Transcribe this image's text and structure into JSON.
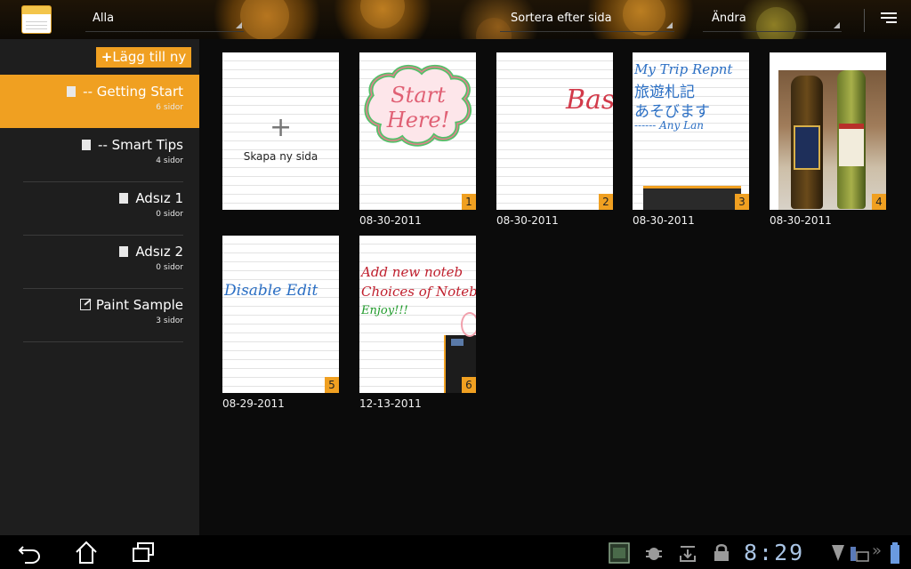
{
  "actionbar": {
    "filter_label": "Alla",
    "sort_label": "Sortera efter sida",
    "edit_label": "Ändra"
  },
  "sidebar": {
    "add_label": "Lägg till ny",
    "notebooks": [
      {
        "title": "-- Getting Start",
        "count": "6 sidor",
        "active": true
      },
      {
        "title": "-- Smart Tips",
        "count": "4 sidor"
      },
      {
        "title": "Adsız 1",
        "count": "0 sidor"
      },
      {
        "title": "Adsız 2",
        "count": "0 sidor"
      },
      {
        "title": "Paint Sample",
        "count": "3 sidor"
      }
    ]
  },
  "pages": {
    "new_page_label": "Skapa ny sida",
    "items": [
      {
        "num": "1",
        "date": "08-30-2011",
        "text": "Start Here!"
      },
      {
        "num": "2",
        "date": "08-30-2011",
        "text": "Bas"
      },
      {
        "num": "3",
        "date": "08-30-2011",
        "lines": [
          "My Trip Repnt",
          "旅遊札記",
          "あそびます",
          "------ Any Lan"
        ]
      },
      {
        "num": "4",
        "date": "08-30-2011"
      },
      {
        "num": "5",
        "date": "08-29-2011",
        "text": "Disable Edit"
      },
      {
        "num": "6",
        "date": "12-13-2011",
        "lines": [
          "Add new noteb",
          "Choices of Noteb",
          "Enjoy!!!"
        ]
      }
    ]
  },
  "system": {
    "clock": "8:29"
  },
  "colors": {
    "accent": "#f0a021",
    "clock": "#a9c4e4"
  }
}
